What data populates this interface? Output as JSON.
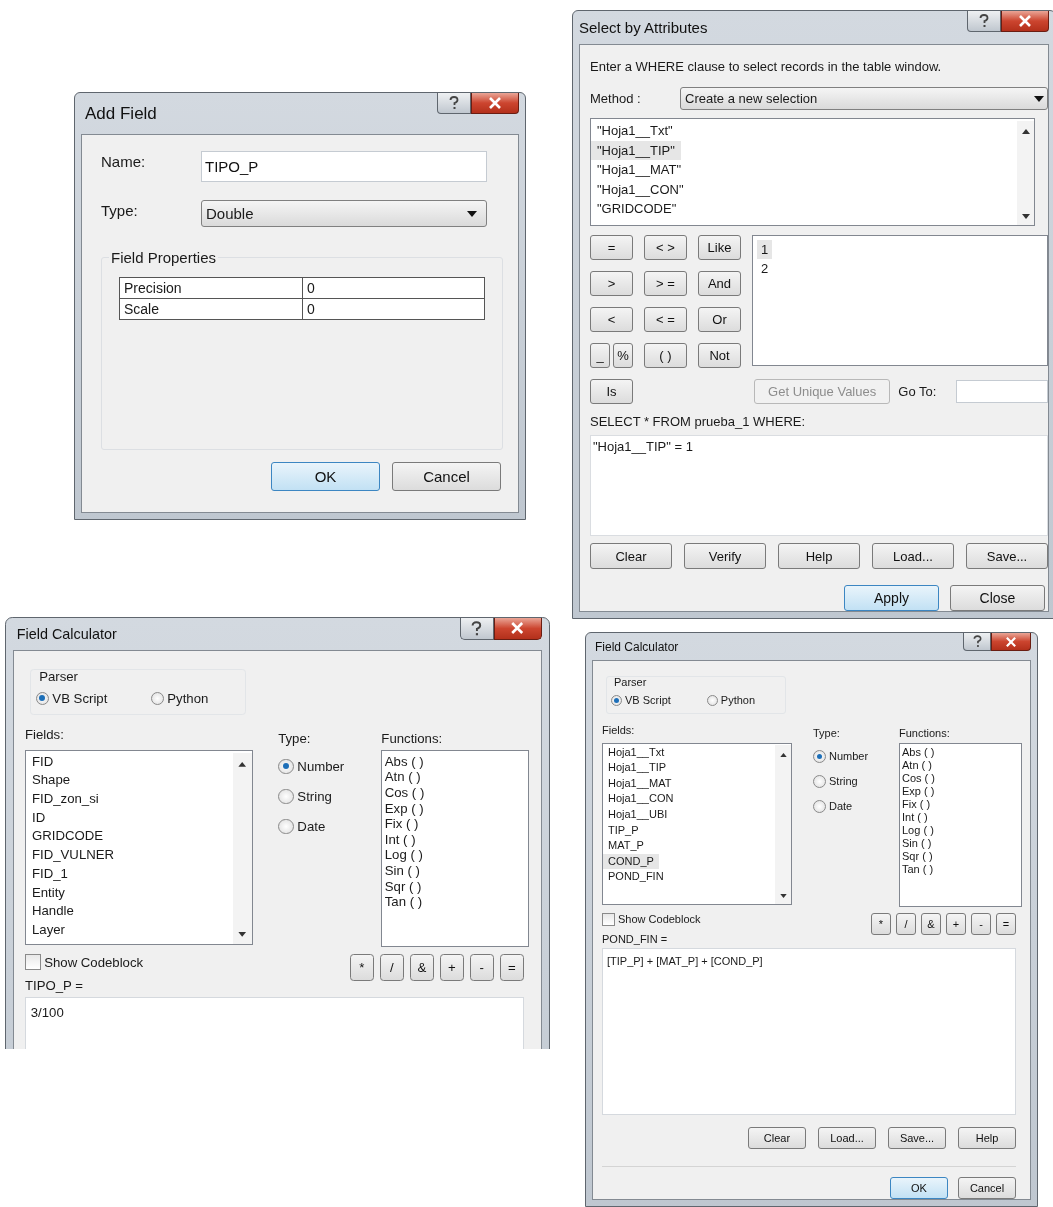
{
  "add_field": {
    "title": "Add Field",
    "name_label": "Name:",
    "name_value": "TIPO_P",
    "type_label": "Type:",
    "type_value": "Double",
    "group_title": "Field Properties",
    "properties": [
      {
        "name": "Precision",
        "value": "0"
      },
      {
        "name": "Scale",
        "value": "0"
      }
    ],
    "buttons": [
      {
        "label": "OK",
        "default": true
      },
      {
        "label": "Cancel",
        "default": false
      }
    ]
  },
  "select_by_attributes": {
    "title": "Select by Attributes",
    "instruction": "Enter a WHERE clause to select records in the table window.",
    "method_label": "Method :",
    "method_value": "Create a new selection",
    "fields": [
      {
        "label": "\"Hoja1__Txt\"",
        "selected": false
      },
      {
        "label": "\"Hoja1__TIP\"",
        "selected": true
      },
      {
        "label": "\"Hoja1__MAT\"",
        "selected": false
      },
      {
        "label": "\"Hoja1__CON\"",
        "selected": false
      },
      {
        "label": "\"GRIDCODE\"",
        "selected": false
      }
    ],
    "operators": [
      [
        [
          "="
        ],
        [
          "< >"
        ],
        [
          "Like"
        ]
      ],
      [
        [
          ">"
        ],
        [
          "> ="
        ],
        [
          "And"
        ]
      ],
      [
        [
          "<"
        ],
        [
          "< ="
        ],
        [
          "Or"
        ]
      ],
      [
        [
          "_",
          "%"
        ],
        [
          "( )"
        ],
        [
          "Not"
        ]
      ],
      [
        [
          "Is"
        ]
      ]
    ],
    "values": [
      {
        "label": "1",
        "selected": true
      },
      {
        "label": "2",
        "selected": false
      }
    ],
    "unique_button": {
      "label": "Get Unique Values",
      "disabled": true
    },
    "goto_label": "Go To:",
    "query_label": "SELECT * FROM prueba_1 WHERE:",
    "query": "\"Hoja1__TIP\" = 1",
    "action_buttons": [
      "Clear",
      "Verify",
      "Help",
      "Load...",
      "Save..."
    ],
    "bottom_buttons": [
      {
        "label": "Apply",
        "default": true
      },
      {
        "label": "Close",
        "default": false
      }
    ]
  },
  "field_calculators": [
    {
      "title": "Field Calculator",
      "parser_label": "Parser",
      "parsers": [
        {
          "label": "VB Script",
          "selected": true
        },
        {
          "label": "Python",
          "selected": false
        }
      ],
      "fields_label": "Fields:",
      "fields": [
        {
          "label": "FID",
          "selected": false
        },
        {
          "label": "Shape",
          "selected": false
        },
        {
          "label": "FID_zon_si",
          "selected": false
        },
        {
          "label": "ID",
          "selected": false
        },
        {
          "label": "GRIDCODE",
          "selected": false
        },
        {
          "label": "FID_VULNER",
          "selected": false
        },
        {
          "label": "FID_1",
          "selected": false
        },
        {
          "label": "Entity",
          "selected": false
        },
        {
          "label": "Handle",
          "selected": false
        },
        {
          "label": "Layer",
          "selected": false
        }
      ],
      "type_label": "Type:",
      "types": [
        {
          "label": "Number",
          "selected": true
        },
        {
          "label": "String",
          "selected": false
        },
        {
          "label": "Date",
          "selected": false
        }
      ],
      "functions_label": "Functions:",
      "functions": [
        "Abs (  )",
        "Atn (  )",
        "Cos (  )",
        "Exp (  )",
        "Fix (  )",
        "Int (  )",
        "Log (  )",
        "Sin (  )",
        "Sqr (  )",
        "Tan (  )"
      ],
      "codeblock": {
        "label": "Show Codeblock",
        "checked": false
      },
      "operators": [
        "*",
        "/",
        "&",
        "+",
        "-",
        "="
      ],
      "expression_label": "TIPO_P =",
      "expression": "3/100"
    },
    {
      "title": "Field Calculator",
      "parser_label": "Parser",
      "parsers": [
        {
          "label": "VB Script",
          "selected": true
        },
        {
          "label": "Python",
          "selected": false
        }
      ],
      "fields_label": "Fields:",
      "fields": [
        {
          "label": "Hoja1__Txt",
          "selected": false
        },
        {
          "label": "Hoja1__TIP",
          "selected": false
        },
        {
          "label": "Hoja1__MAT",
          "selected": false
        },
        {
          "label": "Hoja1__CON",
          "selected": false
        },
        {
          "label": "Hoja1__UBI",
          "selected": false
        },
        {
          "label": "TIP_P",
          "selected": false
        },
        {
          "label": "MAT_P",
          "selected": false
        },
        {
          "label": "COND_P",
          "selected": true
        },
        {
          "label": "POND_FIN",
          "selected": false
        }
      ],
      "type_label": "Type:",
      "types": [
        {
          "label": "Number",
          "selected": true
        },
        {
          "label": "String",
          "selected": false
        },
        {
          "label": "Date",
          "selected": false
        }
      ],
      "functions_label": "Functions:",
      "functions": [
        "Abs (  )",
        "Atn (  )",
        "Cos (  )",
        "Exp (  )",
        "Fix (  )",
        "Int (  )",
        "Log (  )",
        "Sin (  )",
        "Sqr (  )",
        "Tan (  )"
      ],
      "codeblock": {
        "label": "Show Codeblock",
        "checked": false
      },
      "operators": [
        "*",
        "/",
        "&",
        "+",
        "-",
        "="
      ],
      "expression_label": "POND_FIN =",
      "expression": "[TIP_P] + [MAT_P] + [COND_P]",
      "buttons": [
        "Clear",
        "Load...",
        "Save...",
        "Help"
      ],
      "bottom_buttons": [
        {
          "label": "OK",
          "default": true
        },
        {
          "label": "Cancel",
          "default": false
        }
      ]
    }
  ]
}
